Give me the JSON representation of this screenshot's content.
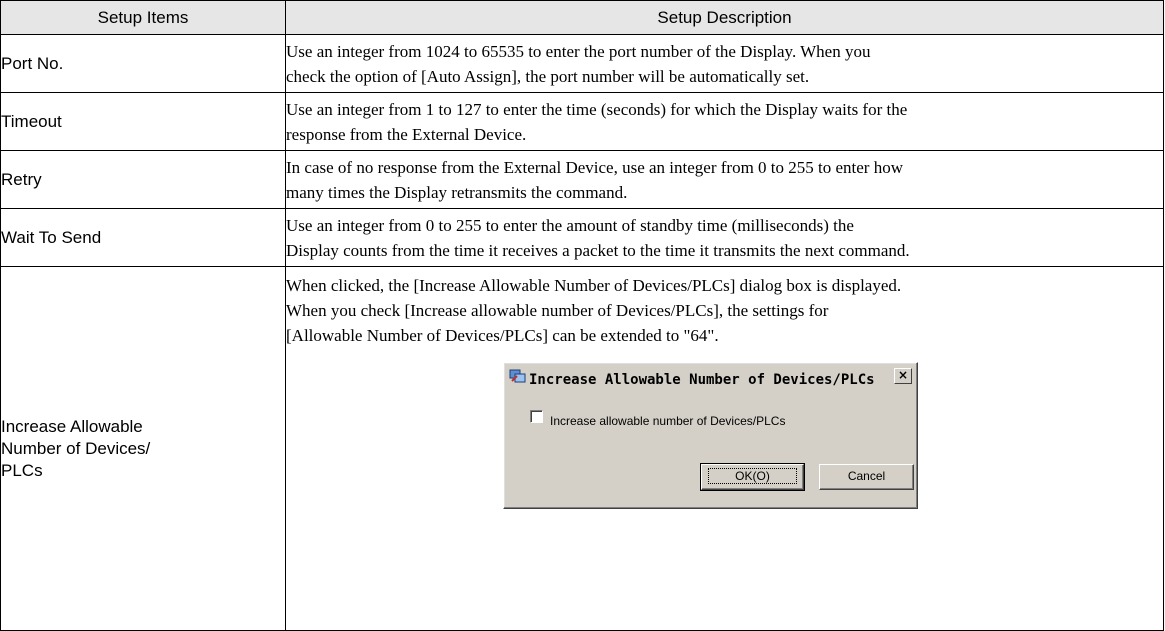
{
  "table": {
    "headers": [
      "Setup Items",
      "Setup Description"
    ],
    "rows": [
      {
        "item": "Port No.",
        "desc": [
          "Use an integer from 1024 to 65535 to enter the port number of the Display. When you",
          "check the option of [Auto Assign], the port number will be automatically set."
        ]
      },
      {
        "item": "Timeout",
        "desc": [
          "Use an integer from 1 to 127 to enter the time (seconds) for which the Display waits for the",
          "response from the External Device."
        ]
      },
      {
        "item": "Retry",
        "desc": [
          "In case of no response from the External Device, use an integer from 0 to 255 to enter how",
          "many times the Display retransmits the command."
        ]
      },
      {
        "item": "Wait To Send",
        "desc": [
          "Use an integer from 0 to 255 to enter the amount of standby time (milliseconds) the",
          "Display counts from the time it receives a packet to the time it transmits the next command."
        ]
      },
      {
        "item": [
          "Increase Allowable",
          "Number of Devices/",
          "PLCs"
        ],
        "desc": [
          "When clicked, the [Increase Allowable Number of Devices/PLCs] dialog box is displayed.",
          "When you check [Increase allowable number of Devices/PLCs], the settings for",
          "[Allowable Number of Devices/PLCs] can be extended to \"64\"."
        ]
      }
    ]
  },
  "dialog": {
    "title": "Increase Allowable Number of Devices/PLCs",
    "close": "×",
    "checkbox_label": "Increase allowable number of Devices/PLCs",
    "checkbox_checked": false,
    "ok_label": "OK(O)",
    "cancel_label": "Cancel"
  }
}
